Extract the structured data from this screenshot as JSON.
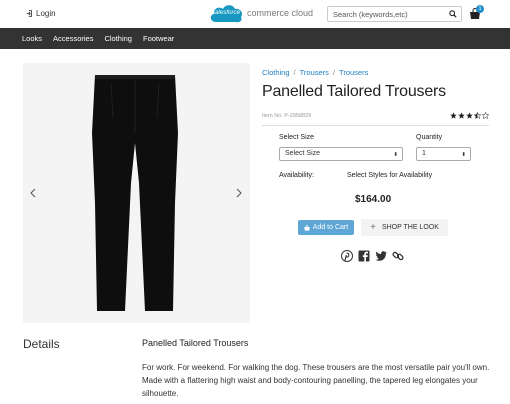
{
  "header": {
    "login_label": "Login",
    "logo_cloud_text": "salesforce",
    "logo_word": "commerce cloud",
    "search_placeholder": "Search (keywords,etc)",
    "cart_count": "1"
  },
  "nav": {
    "items": [
      "Looks",
      "Accessories",
      "Clothing",
      "Footwear"
    ]
  },
  "breadcrumb": [
    "Clothing",
    "Trousers",
    "Trousers"
  ],
  "product": {
    "title": "Panelled Tailored Trousers",
    "item_no": "Item No. P-2958829",
    "rating": 3.5,
    "size_label": "Select Size",
    "size_value": "Select Size",
    "quantity_label": "Quantity",
    "quantity_value": "1",
    "availability_label": "Availability:",
    "availability_value": "Select Styles for Availability",
    "price": "$164.00",
    "add_to_cart": "Add to Cart",
    "shop_the_look": "SHOP THE LOOK"
  },
  "details": {
    "heading": "Details",
    "title": "Panelled Tailored Trousers",
    "body": "For work. For weekend. For walking the dog. These trousers are the most versatile pair you'll own. Made with a flattering high waist and body-contouring panelling, the tapered leg elongates your silhouette."
  },
  "colors": {
    "nav_bg": "#333333",
    "link": "#1f7fc1",
    "cart_button": "#5da6d6",
    "badge": "#1f8ec9",
    "logo_cloud": "#1798c1"
  }
}
